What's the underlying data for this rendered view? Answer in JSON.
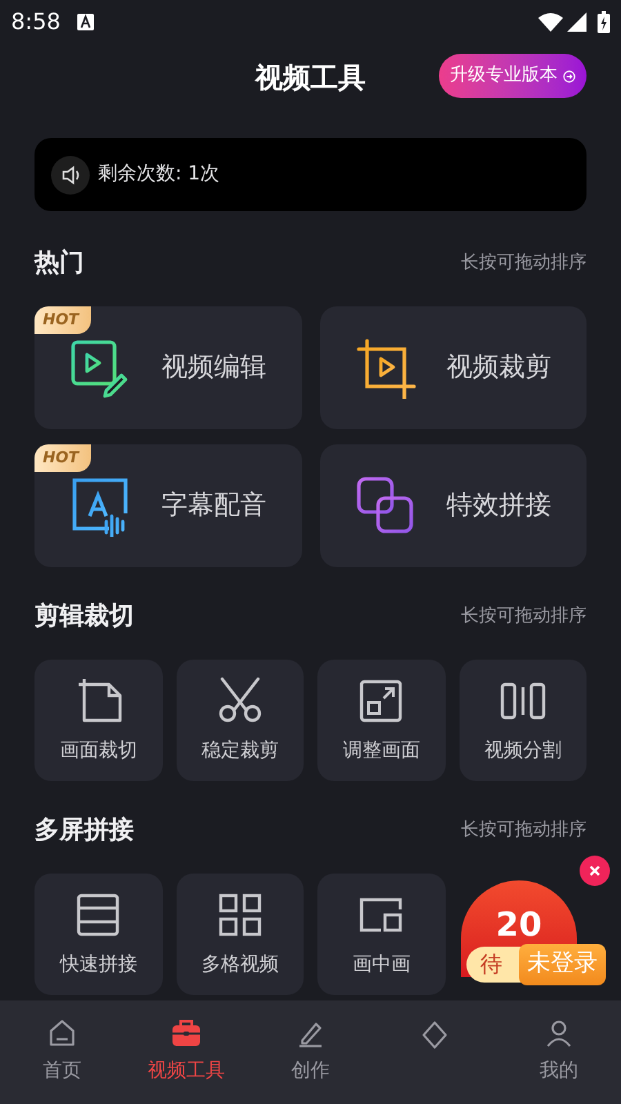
{
  "status_bar": {
    "time": "8:58"
  },
  "header": {
    "title": "视频工具",
    "upgrade_button": "升级专业版本"
  },
  "notice": {
    "text": "剩余次数: 1次"
  },
  "sections": [
    {
      "title": "热门",
      "hint": "长按可拖动排序",
      "kind": "large",
      "items": [
        {
          "label": "视频编辑",
          "badge": "HOT"
        },
        {
          "label": "视频裁剪"
        },
        {
          "label": "字幕配音",
          "badge": "HOT"
        },
        {
          "label": "特效拼接"
        }
      ]
    },
    {
      "title": "剪辑裁切",
      "hint": "长按可拖动排序",
      "kind": "small",
      "items": [
        {
          "label": "画面裁切"
        },
        {
          "label": "稳定裁剪"
        },
        {
          "label": "调整画面"
        },
        {
          "label": "视频分割"
        }
      ]
    },
    {
      "title": "多屏拼接",
      "hint": "长按可拖动排序",
      "kind": "small",
      "items": [
        {
          "label": "快速拼接"
        },
        {
          "label": "多格视频"
        },
        {
          "label": "画中画"
        }
      ]
    }
  ],
  "promo": {
    "amount": "20",
    "caption": "待",
    "tag": "未登录"
  },
  "bottom_nav": [
    {
      "label": "首页",
      "selected": false
    },
    {
      "label": "视频工具",
      "selected": true
    },
    {
      "label": "创作",
      "selected": false
    },
    {
      "selected": false
    },
    {
      "label": "我的",
      "selected": false
    }
  ]
}
